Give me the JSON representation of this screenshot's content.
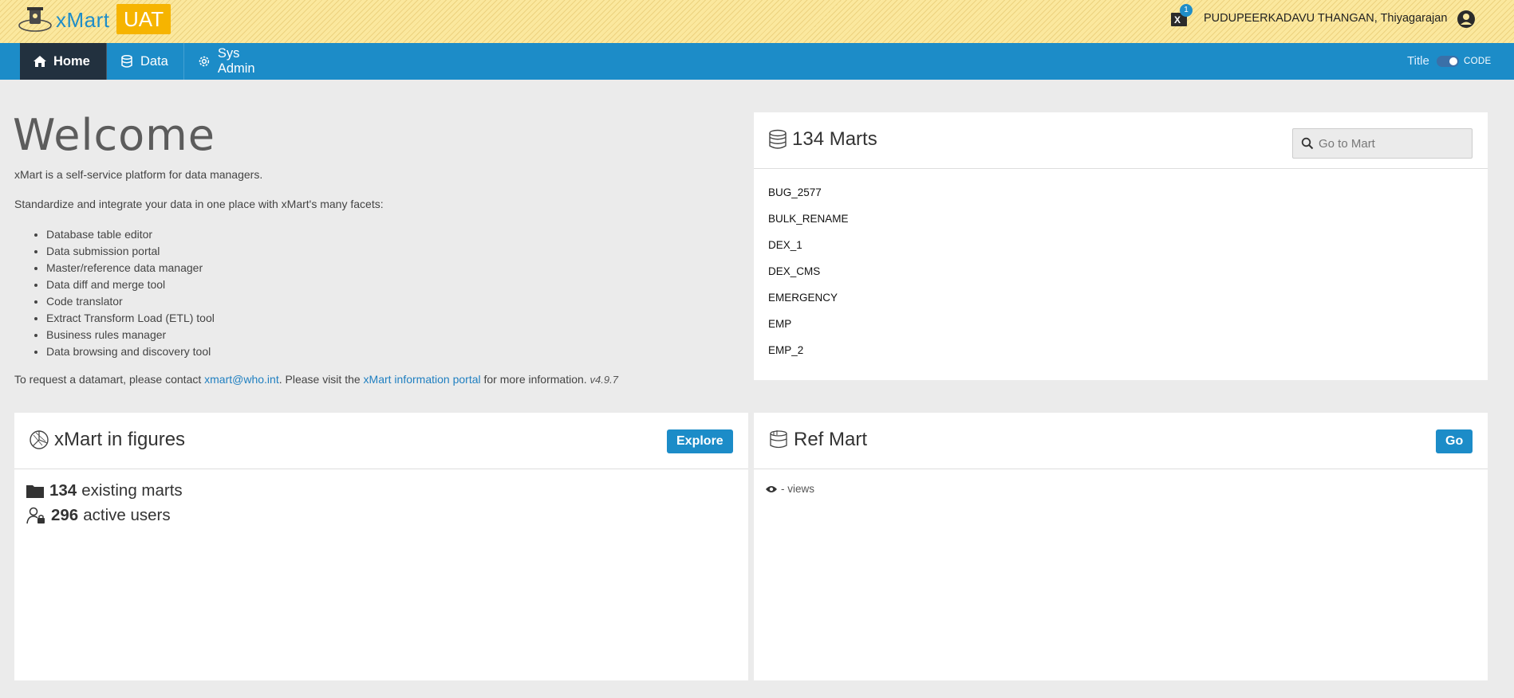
{
  "header": {
    "logo_text": "xMart",
    "env_badge": "UAT",
    "notification_count": "1",
    "username": "PUDUPEERKADAVU THANGAN, Thiyagarajan"
  },
  "nav": {
    "items": [
      {
        "label": "Home",
        "icon": "home-icon",
        "active": true
      },
      {
        "label": "Data",
        "icon": "database-icon",
        "active": false
      },
      {
        "label": "Sys Admin",
        "icon": "gear-icon",
        "active": false
      }
    ],
    "toggle_left_label": "Title",
    "toggle_right_label": "CODE"
  },
  "welcome": {
    "title": "Welcome",
    "intro": "xMart is a self-service platform for data managers.",
    "facets_intro": "Standardize and integrate your data in one place with xMart's many facets:",
    "facets": [
      "Database table editor",
      "Data submission portal",
      "Master/reference data manager",
      "Data diff and merge tool",
      "Code translator",
      "Extract Transform Load (ETL) tool",
      "Business rules manager",
      "Data browsing and discovery tool"
    ],
    "contact_prefix": "To request a datamart, please contact ",
    "contact_email": "xmart@who.int",
    "contact_mid": ". Please visit the ",
    "portal_link": "xMart information portal",
    "contact_suffix": " for more information. ",
    "version": "v4.9.7"
  },
  "marts": {
    "title": "134 Marts",
    "search_placeholder": "Go to Mart",
    "items": [
      "BUG_2577",
      "BULK_RENAME",
      "DEX_1",
      "DEX_CMS",
      "EMERGENCY",
      "EMP",
      "EMP_2"
    ]
  },
  "figures": {
    "title": "xMart in figures",
    "button": "Explore",
    "marts_count": "134",
    "marts_label": "existing marts",
    "users_count": "296",
    "users_label": "active users"
  },
  "refmart": {
    "title": "Ref Mart",
    "button": "Go",
    "views_text": "- views"
  },
  "colors": {
    "header_bg": "#fbe89e",
    "nav_bg": "#1c8cc8",
    "nav_active": "#22313f",
    "badge": "#f6b400",
    "accent": "#1c8cc8"
  }
}
